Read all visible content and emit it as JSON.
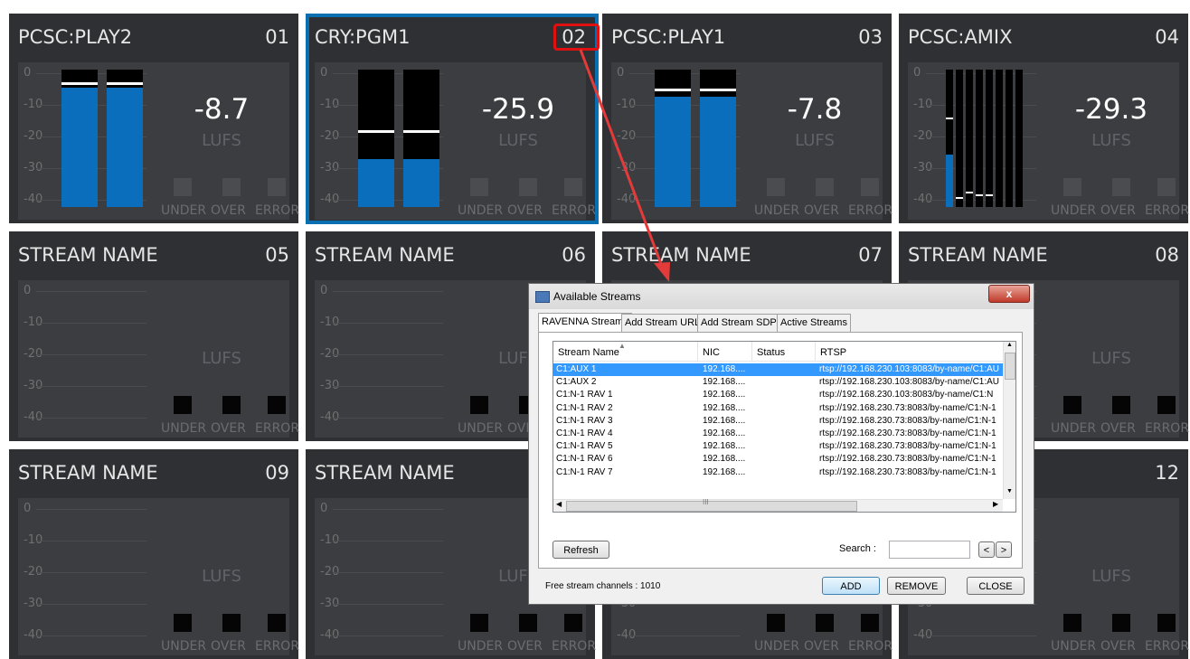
{
  "scale_labels": [
    "0",
    "-10",
    "-20",
    "-30",
    "-40"
  ],
  "unit_label": "LUFS",
  "indicator_labels": [
    "UNDER",
    "OVER",
    "ERROR"
  ],
  "tiles": [
    {
      "name": "PCSC:PLAY2",
      "number": "01",
      "value": "-8.7",
      "active": true
    },
    {
      "name": "CRY:PGM1",
      "number": "02",
      "value": "-25.9",
      "active": true,
      "selected": true
    },
    {
      "name": "PCSC:PLAY1",
      "number": "03",
      "value": "-7.8",
      "active": true
    },
    {
      "name": "PCSC:AMIX",
      "number": "04",
      "value": "-29.3",
      "active": true
    },
    {
      "name": "STREAM NAME",
      "number": "05",
      "value": "",
      "active": false
    },
    {
      "name": "STREAM NAME",
      "number": "06",
      "value": "",
      "active": false
    },
    {
      "name": "STREAM NAME",
      "number": "07",
      "value": "",
      "active": false
    },
    {
      "name": "STREAM NAME",
      "number": "08",
      "value": "",
      "active": false
    },
    {
      "name": "STREAM NAME",
      "number": "09",
      "value": "",
      "active": false
    },
    {
      "name": "STREAM NAME",
      "number": "",
      "value": "",
      "active": false
    },
    {
      "name": "",
      "number": "",
      "value": "",
      "active": false
    },
    {
      "name": "E",
      "number": "12",
      "value": "",
      "active": false
    }
  ],
  "meter_levels": {
    "01": {
      "fill": [
        0.87,
        0.87
      ],
      "peak": [
        0.89,
        0.89
      ]
    },
    "02": {
      "fill": [
        0.35,
        0.35
      ],
      "peak": [
        0.54,
        0.54
      ]
    },
    "03": {
      "fill": [
        0.8,
        0.8
      ],
      "peak": [
        0.84,
        0.84
      ]
    },
    "04": {
      "fill": [
        0.38,
        0.0,
        0.0,
        0.0,
        0.0,
        0.0,
        0.0,
        0.0
      ],
      "peak": [
        0.64,
        0.06,
        0.1,
        0.08,
        0.08,
        0.0,
        0.0,
        0.0
      ]
    }
  },
  "dialog": {
    "title": "Available Streams",
    "close_glyph": "x",
    "tabs": [
      "RAVENNA Streams",
      "Add Stream URL",
      "Add Stream SDP",
      "Active Streams"
    ],
    "columns": [
      "Stream Name",
      "NIC",
      "Status",
      "RTSP"
    ],
    "rows": [
      {
        "name": "C1:AUX 1",
        "nic": "192.168....",
        "status": "",
        "rtsp": "rtsp://192.168.230.103:8083/by-name/C1:AU"
      },
      {
        "name": "C1:AUX 2",
        "nic": "192.168....",
        "status": "",
        "rtsp": "rtsp://192.168.230.103:8083/by-name/C1:AU"
      },
      {
        "name": "C1:N-1 RAV 1",
        "nic": "192.168....",
        "status": "",
        "rtsp": "rtsp://192.168.230.103:8083/by-name/C1:N"
      },
      {
        "name": "C1:N-1 RAV 2",
        "nic": "192.168....",
        "status": "",
        "rtsp": "rtsp://192.168.230.73:8083/by-name/C1:N-1"
      },
      {
        "name": "C1:N-1 RAV 3",
        "nic": "192.168....",
        "status": "",
        "rtsp": "rtsp://192.168.230.73:8083/by-name/C1:N-1"
      },
      {
        "name": "C1:N-1 RAV 4",
        "nic": "192.168....",
        "status": "",
        "rtsp": "rtsp://192.168.230.73:8083/by-name/C1:N-1"
      },
      {
        "name": "C1:N-1 RAV 5",
        "nic": "192.168....",
        "status": "",
        "rtsp": "rtsp://192.168.230.73:8083/by-name/C1:N-1"
      },
      {
        "name": "C1:N-1 RAV 6",
        "nic": "192.168....",
        "status": "",
        "rtsp": "rtsp://192.168.230.73:8083/by-name/C1:N-1"
      },
      {
        "name": "C1:N-1 RAV 7",
        "nic": "192.168....",
        "status": "",
        "rtsp": "rtsp://192.168.230.73:8083/by-name/C1:N-1"
      }
    ],
    "scroll_glyph": "III",
    "refresh_label": "Refresh",
    "search_label": "Search :",
    "search_value": "",
    "prev_label": "<",
    "next_label": ">",
    "free_channels_label": "Free stream channels : 1010",
    "add_label": "ADD",
    "remove_label": "REMOVE",
    "close_label": "CLOSE"
  },
  "colors": {
    "accent": "#0a6ebd",
    "highlight": "#e01010",
    "selection": "#3399ff"
  }
}
